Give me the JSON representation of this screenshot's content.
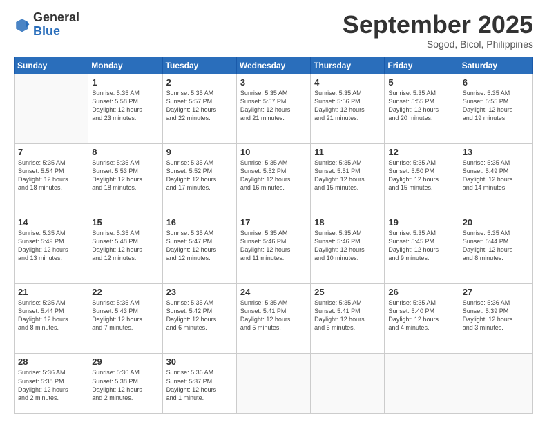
{
  "logo": {
    "general": "General",
    "blue": "Blue"
  },
  "header": {
    "month": "September 2025",
    "location": "Sogod, Bicol, Philippines"
  },
  "weekdays": [
    "Sunday",
    "Monday",
    "Tuesday",
    "Wednesday",
    "Thursday",
    "Friday",
    "Saturday"
  ],
  "weeks": [
    [
      {
        "day": "",
        "info": ""
      },
      {
        "day": "1",
        "info": "Sunrise: 5:35 AM\nSunset: 5:58 PM\nDaylight: 12 hours\nand 23 minutes."
      },
      {
        "day": "2",
        "info": "Sunrise: 5:35 AM\nSunset: 5:57 PM\nDaylight: 12 hours\nand 22 minutes."
      },
      {
        "day": "3",
        "info": "Sunrise: 5:35 AM\nSunset: 5:57 PM\nDaylight: 12 hours\nand 21 minutes."
      },
      {
        "day": "4",
        "info": "Sunrise: 5:35 AM\nSunset: 5:56 PM\nDaylight: 12 hours\nand 21 minutes."
      },
      {
        "day": "5",
        "info": "Sunrise: 5:35 AM\nSunset: 5:55 PM\nDaylight: 12 hours\nand 20 minutes."
      },
      {
        "day": "6",
        "info": "Sunrise: 5:35 AM\nSunset: 5:55 PM\nDaylight: 12 hours\nand 19 minutes."
      }
    ],
    [
      {
        "day": "7",
        "info": "Sunrise: 5:35 AM\nSunset: 5:54 PM\nDaylight: 12 hours\nand 18 minutes."
      },
      {
        "day": "8",
        "info": "Sunrise: 5:35 AM\nSunset: 5:53 PM\nDaylight: 12 hours\nand 18 minutes."
      },
      {
        "day": "9",
        "info": "Sunrise: 5:35 AM\nSunset: 5:52 PM\nDaylight: 12 hours\nand 17 minutes."
      },
      {
        "day": "10",
        "info": "Sunrise: 5:35 AM\nSunset: 5:52 PM\nDaylight: 12 hours\nand 16 minutes."
      },
      {
        "day": "11",
        "info": "Sunrise: 5:35 AM\nSunset: 5:51 PM\nDaylight: 12 hours\nand 15 minutes."
      },
      {
        "day": "12",
        "info": "Sunrise: 5:35 AM\nSunset: 5:50 PM\nDaylight: 12 hours\nand 15 minutes."
      },
      {
        "day": "13",
        "info": "Sunrise: 5:35 AM\nSunset: 5:49 PM\nDaylight: 12 hours\nand 14 minutes."
      }
    ],
    [
      {
        "day": "14",
        "info": "Sunrise: 5:35 AM\nSunset: 5:49 PM\nDaylight: 12 hours\nand 13 minutes."
      },
      {
        "day": "15",
        "info": "Sunrise: 5:35 AM\nSunset: 5:48 PM\nDaylight: 12 hours\nand 12 minutes."
      },
      {
        "day": "16",
        "info": "Sunrise: 5:35 AM\nSunset: 5:47 PM\nDaylight: 12 hours\nand 12 minutes."
      },
      {
        "day": "17",
        "info": "Sunrise: 5:35 AM\nSunset: 5:46 PM\nDaylight: 12 hours\nand 11 minutes."
      },
      {
        "day": "18",
        "info": "Sunrise: 5:35 AM\nSunset: 5:46 PM\nDaylight: 12 hours\nand 10 minutes."
      },
      {
        "day": "19",
        "info": "Sunrise: 5:35 AM\nSunset: 5:45 PM\nDaylight: 12 hours\nand 9 minutes."
      },
      {
        "day": "20",
        "info": "Sunrise: 5:35 AM\nSunset: 5:44 PM\nDaylight: 12 hours\nand 8 minutes."
      }
    ],
    [
      {
        "day": "21",
        "info": "Sunrise: 5:35 AM\nSunset: 5:44 PM\nDaylight: 12 hours\nand 8 minutes."
      },
      {
        "day": "22",
        "info": "Sunrise: 5:35 AM\nSunset: 5:43 PM\nDaylight: 12 hours\nand 7 minutes."
      },
      {
        "day": "23",
        "info": "Sunrise: 5:35 AM\nSunset: 5:42 PM\nDaylight: 12 hours\nand 6 minutes."
      },
      {
        "day": "24",
        "info": "Sunrise: 5:35 AM\nSunset: 5:41 PM\nDaylight: 12 hours\nand 5 minutes."
      },
      {
        "day": "25",
        "info": "Sunrise: 5:35 AM\nSunset: 5:41 PM\nDaylight: 12 hours\nand 5 minutes."
      },
      {
        "day": "26",
        "info": "Sunrise: 5:35 AM\nSunset: 5:40 PM\nDaylight: 12 hours\nand 4 minutes."
      },
      {
        "day": "27",
        "info": "Sunrise: 5:36 AM\nSunset: 5:39 PM\nDaylight: 12 hours\nand 3 minutes."
      }
    ],
    [
      {
        "day": "28",
        "info": "Sunrise: 5:36 AM\nSunset: 5:38 PM\nDaylight: 12 hours\nand 2 minutes."
      },
      {
        "day": "29",
        "info": "Sunrise: 5:36 AM\nSunset: 5:38 PM\nDaylight: 12 hours\nand 2 minutes."
      },
      {
        "day": "30",
        "info": "Sunrise: 5:36 AM\nSunset: 5:37 PM\nDaylight: 12 hours\nand 1 minute."
      },
      {
        "day": "",
        "info": ""
      },
      {
        "day": "",
        "info": ""
      },
      {
        "day": "",
        "info": ""
      },
      {
        "day": "",
        "info": ""
      }
    ]
  ]
}
